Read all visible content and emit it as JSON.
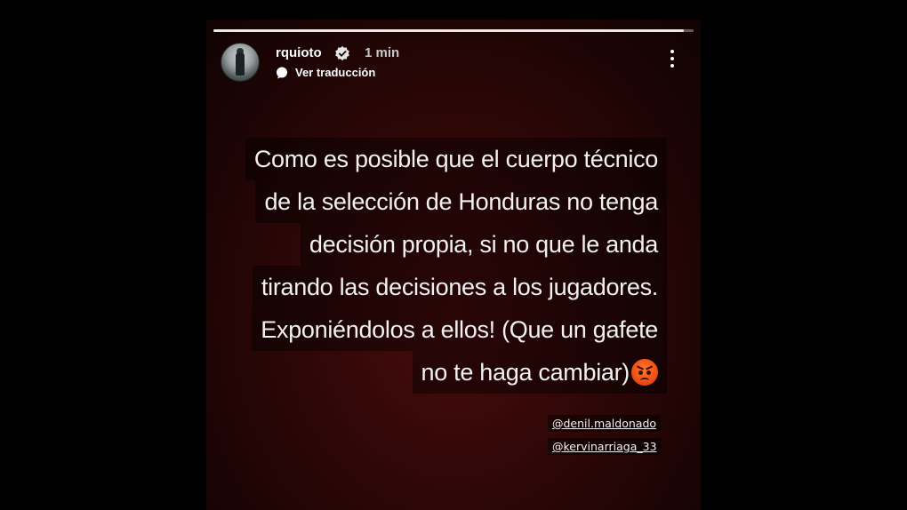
{
  "story": {
    "progress": 0.98,
    "username": "rquioto",
    "verified": true,
    "time": "1 min",
    "translate_label": "Ver traducción",
    "text_lines": [
      "Como es posible que el cuerpo técnico",
      "de la selección de Honduras no tenga",
      "decisión propia, si no que le anda",
      "tirando las decisiones a los jugadores.",
      "Exponiéndolos a ellos! (Que un gafete",
      "no te haga cambiar)"
    ],
    "emoji": "angry-face",
    "mentions": [
      "@denil.maldonado",
      "@kervinarriaga_33"
    ]
  },
  "colors": {
    "background": "#000000",
    "story_bg": "#3a0808",
    "text": "#f1f1f1"
  }
}
